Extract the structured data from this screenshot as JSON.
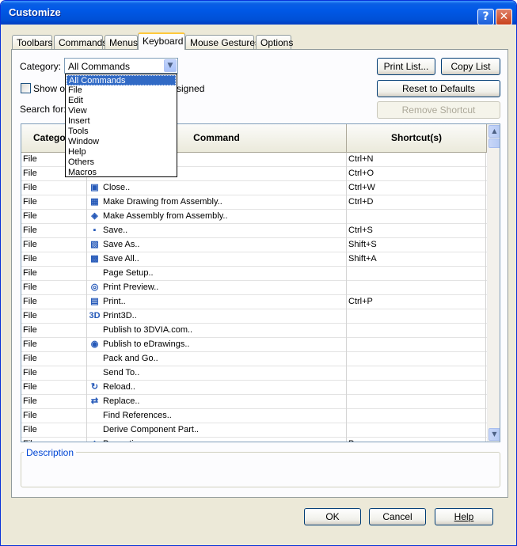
{
  "window": {
    "title": "Customize",
    "help_glyph": "?",
    "close_glyph": "✕"
  },
  "tabs": [
    {
      "label": "Toolbars"
    },
    {
      "label": "Commands"
    },
    {
      "label": "Menus"
    },
    {
      "label": "Keyboard"
    },
    {
      "label": "Mouse Gestures"
    },
    {
      "label": "Options"
    }
  ],
  "active_tab": "Keyboard",
  "category": {
    "label": "Category:",
    "value": "All Commands",
    "options": [
      "All Commands",
      "File",
      "Edit",
      "View",
      "Insert",
      "Tools",
      "Window",
      "Help",
      "Others",
      "Macros"
    ]
  },
  "show_only": {
    "label_start": "Show on",
    "label_end": "signed",
    "checked": false
  },
  "search": {
    "label": "Search for:"
  },
  "buttons": {
    "print_list": "Print List...",
    "copy_list": "Copy List",
    "reset_defaults": "Reset to Defaults",
    "remove_shortcut": "Remove Shortcut",
    "ok": "OK",
    "cancel": "Cancel",
    "help": "Help"
  },
  "table": {
    "headers": {
      "category": "Category",
      "command": "Command",
      "shortcut": "Shortcut(s)"
    },
    "rows": [
      {
        "category": "File",
        "command": "",
        "shortcut": "Ctrl+N",
        "icon": "none"
      },
      {
        "category": "File",
        "command": "",
        "shortcut": "Ctrl+O",
        "icon": "none"
      },
      {
        "category": "File",
        "command": "Close..",
        "shortcut": "Ctrl+W",
        "icon": "close-folder-icon"
      },
      {
        "category": "File",
        "command": "Make Drawing from Assembly..",
        "shortcut": "Ctrl+D",
        "icon": "drawing-icon"
      },
      {
        "category": "File",
        "command": "Make Assembly from Assembly..",
        "shortcut": "",
        "icon": "assembly-icon"
      },
      {
        "category": "File",
        "command": "Save..",
        "shortcut": "Ctrl+S",
        "icon": "save-icon"
      },
      {
        "category": "File",
        "command": "Save As..",
        "shortcut": "Shift+S",
        "icon": "save-as-icon"
      },
      {
        "category": "File",
        "command": "Save All..",
        "shortcut": "Shift+A",
        "icon": "save-all-icon"
      },
      {
        "category": "File",
        "command": "Page Setup..",
        "shortcut": "",
        "icon": "none"
      },
      {
        "category": "File",
        "command": "Print Preview..",
        "shortcut": "",
        "icon": "print-preview-icon"
      },
      {
        "category": "File",
        "command": "Print..",
        "shortcut": "Ctrl+P",
        "icon": "print-icon"
      },
      {
        "category": "File",
        "command": "Print3D..",
        "shortcut": "",
        "icon": "print3d-icon"
      },
      {
        "category": "File",
        "command": "Publish to 3DVIA.com..",
        "shortcut": "",
        "icon": "none"
      },
      {
        "category": "File",
        "command": "Publish to eDrawings..",
        "shortcut": "",
        "icon": "edrawings-icon"
      },
      {
        "category": "File",
        "command": "Pack and Go..",
        "shortcut": "",
        "icon": "none"
      },
      {
        "category": "File",
        "command": "Send To..",
        "shortcut": "",
        "icon": "none"
      },
      {
        "category": "File",
        "command": "Reload..",
        "shortcut": "",
        "icon": "reload-icon"
      },
      {
        "category": "File",
        "command": "Replace..",
        "shortcut": "",
        "icon": "replace-icon"
      },
      {
        "category": "File",
        "command": "Find References..",
        "shortcut": "",
        "icon": "none"
      },
      {
        "category": "File",
        "command": "Derive Component Part..",
        "shortcut": "",
        "icon": "none"
      },
      {
        "category": "File",
        "command": "Properties..",
        "shortcut": "P",
        "icon": "properties-icon"
      }
    ]
  },
  "description": {
    "label": "Description"
  },
  "icons": {
    "close-folder-icon": "▣",
    "drawing-icon": "▦",
    "assembly-icon": "◈",
    "save-icon": "▪",
    "save-as-icon": "▧",
    "save-all-icon": "▩",
    "print-preview-icon": "◎",
    "print-icon": "▤",
    "print3d-icon": "3D",
    "edrawings-icon": "◉",
    "reload-icon": "↻",
    "replace-icon": "⇄",
    "properties-icon": "◆",
    "none": ""
  }
}
